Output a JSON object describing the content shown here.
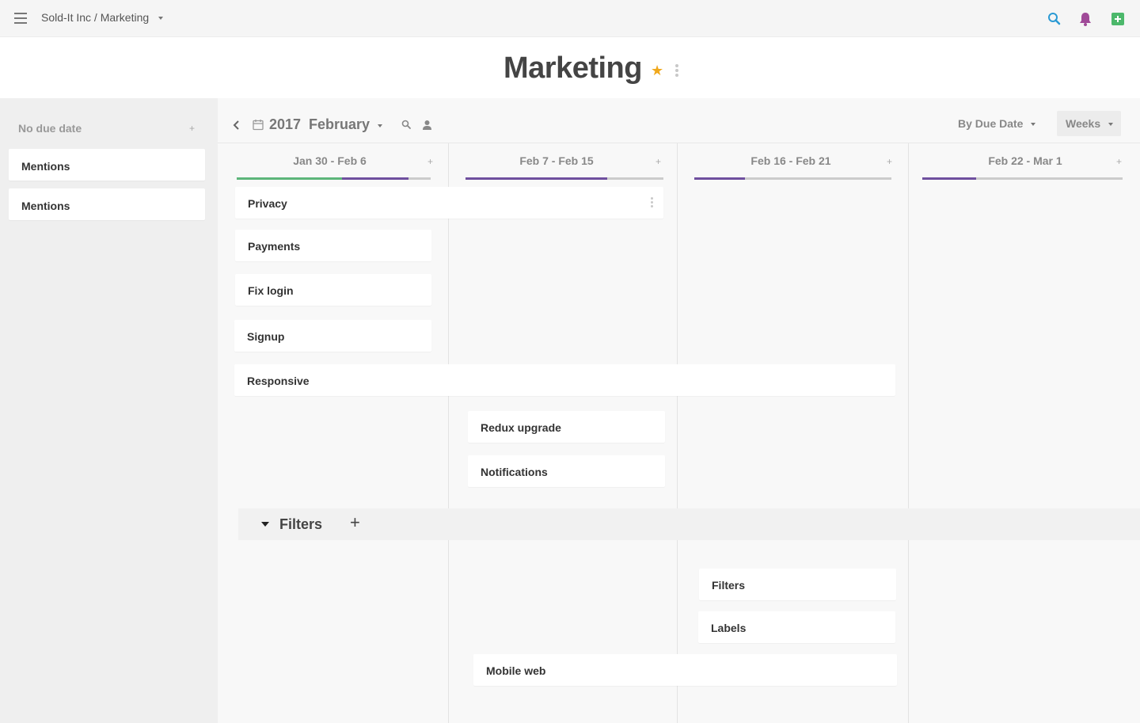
{
  "topbar": {
    "breadcrumb": "Sold-It Inc / Marketing"
  },
  "header": {
    "title": "Marketing"
  },
  "sidebar": {
    "no_due_date_label": "No due date",
    "cards": [
      "Mentions",
      "Mentions"
    ]
  },
  "toolbar": {
    "year": "2017",
    "month": "February",
    "sort_label": "By Due Date",
    "view_label": "Weeks"
  },
  "columns": [
    {
      "title": "Jan 30 - Feb 6"
    },
    {
      "title": "Feb 7 - Feb 15"
    },
    {
      "title": "Feb 16 - Feb 21"
    },
    {
      "title": "Feb 22 - Mar 1"
    }
  ],
  "cards": {
    "privacy": "Privacy",
    "payments": "Payments",
    "fix_login": "Fix login",
    "signup": "Signup",
    "responsive": "Responsive",
    "redux_upgrade": "Redux upgrade",
    "notifications": "Notifications",
    "filters": "Filters",
    "labels": "Labels",
    "mobile_web": "Mobile web"
  },
  "filters_group": {
    "title": "Filters"
  },
  "colors": {
    "accent_green": "#5cb57a",
    "accent_purple": "#6f4f9e",
    "search_blue": "#2a9ad4",
    "bell_purple": "#a04a98",
    "add_green": "#4cb86b",
    "star": "#f0a81c"
  }
}
